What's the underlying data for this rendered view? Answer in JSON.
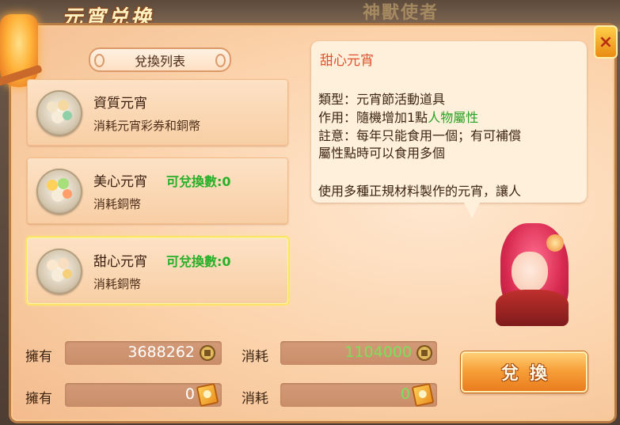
{
  "window": {
    "title": "元宵兑换",
    "background_heading": "神獸使者",
    "close_label": "×"
  },
  "list": {
    "header": "兌換列表",
    "items": [
      {
        "name": "資質元宵",
        "count_label": "",
        "cost": "消耗元宵彩券和銅幣",
        "icon": "tangyuan-bowl-icon",
        "selected": false
      },
      {
        "name": "美心元宵",
        "count_label": "可兌換數:0",
        "cost": "消耗銅幣",
        "icon": "colorful-tangyuan-bowl-icon",
        "selected": false
      },
      {
        "name": "甜心元宵",
        "count_label": "可兌換數:0",
        "cost": "消耗銅幣",
        "icon": "sweet-tangyuan-bowl-icon",
        "selected": true
      }
    ]
  },
  "detail": {
    "title": "甜心元宵",
    "type_line": "類型：元宵節活動道具",
    "effect_prefix": "作用：隨機增加1點",
    "effect_highlight": "人物屬性",
    "note_line1": "註意：每年只能食用一個；有可補償",
    "note_line2": "屬性點時可以食用多個",
    "desc_line": "使用多種正規材料製作的元宵，讓人"
  },
  "resources": {
    "row1": {
      "own_label": "擁有",
      "own_value": "3688262",
      "cost_label": "消耗",
      "cost_value": "1104000",
      "currency_icon": "copper-coin-icon"
    },
    "row2": {
      "own_label": "擁有",
      "own_value": "0",
      "cost_label": "消耗",
      "cost_value": "0",
      "currency_icon": "lantern-ticket-icon"
    }
  },
  "actions": {
    "exchange_label": "兌換"
  },
  "colors": {
    "title_accent": "#e0522e",
    "green_text": "#27b027",
    "button_orange": "#f7a13a"
  }
}
